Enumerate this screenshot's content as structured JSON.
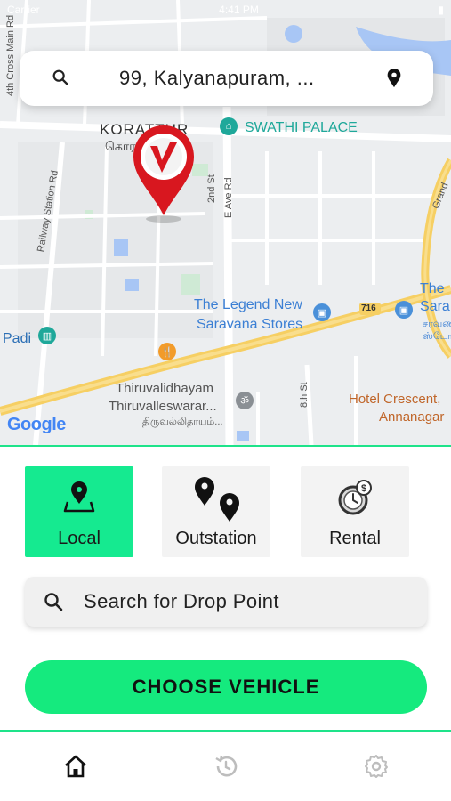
{
  "status_bar": {
    "carrier": "Carrier",
    "time": "4:41 PM"
  },
  "search": {
    "address": "99, Kalyanapuram, ..."
  },
  "map": {
    "places": {
      "korattur_en": "KORATTUR",
      "korattur_ta": "கொரட்டூர்",
      "swathi_palace": "SWATHI PALACE",
      "legend_line1": "The Legend New",
      "legend_line2": "Saravana Stores",
      "road_716": "716",
      "padi": "Padi",
      "thiru_line1": "Thiruvalidhayam",
      "thiru_line2": "Thiruvalleswarar...",
      "thiru_ta": "திருவல்லிதாயம்...",
      "hotel_line1": "Hotel Crescent,",
      "hotel_line2": "Annanagar",
      "the_sara_line1": "The",
      "the_sara_line2": "Sara",
      "the_sara_ta": "சரவண",
      "stores_ta": "ஸ்டோ"
    },
    "roads": {
      "r1": "4th Cross Main Rd",
      "r2": "Railway Station Rd",
      "r3": "2nd St",
      "r4": "E Ave Rd",
      "r5": "8th St",
      "r6": "Grand"
    },
    "attribution": "Google"
  },
  "services": [
    {
      "label": "Local",
      "icon": "map-pin-icon",
      "active": true
    },
    {
      "label": "Outstation",
      "icon": "two-pins-icon",
      "active": false
    },
    {
      "label": "Rental",
      "icon": "clock-dollar-icon",
      "active": false
    }
  ],
  "drop": {
    "placeholder": "Search for Drop Point"
  },
  "cta": {
    "label": "CHOOSE VEHICLE"
  },
  "nav": [
    {
      "name": "home",
      "icon": "home-icon"
    },
    {
      "name": "history",
      "icon": "history-icon"
    },
    {
      "name": "settings",
      "icon": "gear-icon"
    }
  ],
  "colors": {
    "accent": "#15ea7e",
    "tile_active": "#15ea90",
    "pin_red": "#d8171f",
    "poi_blue": "#4a90d9",
    "poi_teal": "#1fa89a",
    "poi_orange": "#f29b2a",
    "road_yellow": "#f6cf63"
  }
}
